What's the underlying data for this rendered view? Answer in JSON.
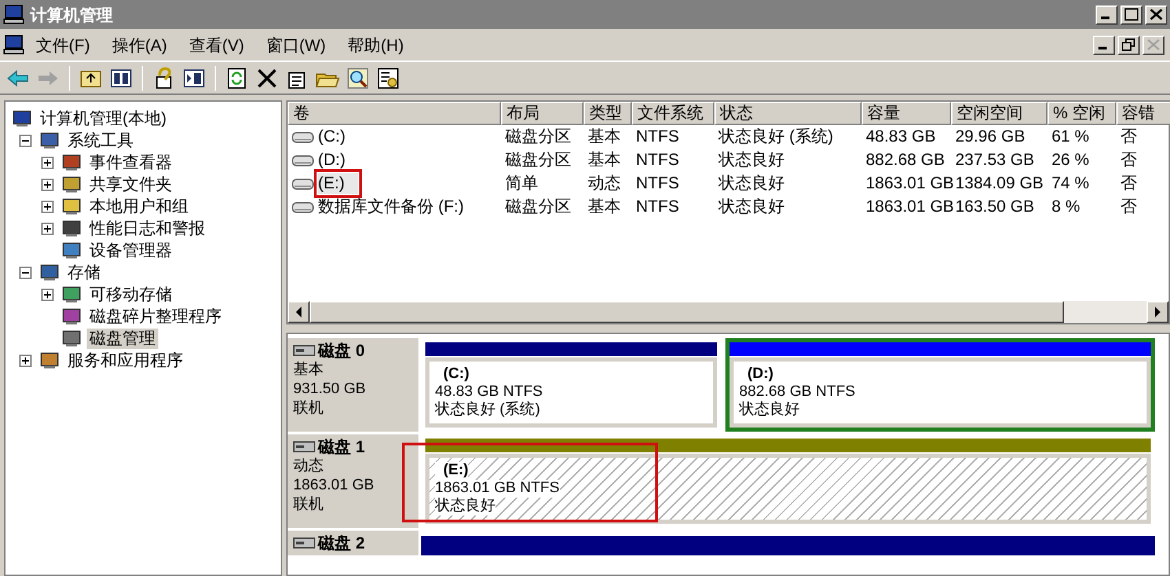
{
  "window": {
    "title": "计算机管理"
  },
  "menu": [
    "文件(F)",
    "操作(A)",
    "查看(V)",
    "窗口(W)",
    "帮助(H)"
  ],
  "tree": [
    {
      "label": "计算机管理(本地)",
      "selected": false,
      "children": [
        {
          "label": "系统工具",
          "expanded": true,
          "selected": false,
          "children": [
            {
              "label": "事件查看器",
              "expanded": false,
              "selected": false
            },
            {
              "label": "共享文件夹",
              "expanded": false,
              "selected": false
            },
            {
              "label": "本地用户和组",
              "expanded": false,
              "selected": false
            },
            {
              "label": "性能日志和警报",
              "expanded": false,
              "selected": false
            },
            {
              "label": "设备管理器",
              "selected": false
            }
          ]
        },
        {
          "label": "存储",
          "expanded": true,
          "selected": false,
          "children": [
            {
              "label": "可移动存储",
              "expanded": false,
              "selected": false
            },
            {
              "label": "磁盘碎片整理程序",
              "selected": false
            },
            {
              "label": "磁盘管理",
              "selected": true
            }
          ]
        },
        {
          "label": "服务和应用程序",
          "expanded": false,
          "selected": false
        }
      ]
    }
  ],
  "table": {
    "columns": [
      "卷",
      "布局",
      "类型",
      "文件系统",
      "状态",
      "容量",
      "空闲空间",
      "% 空闲",
      "容错"
    ],
    "rows": [
      {
        "cells": [
          "(C:)",
          "磁盘分区",
          "基本",
          "NTFS",
          "状态良好 (系统)",
          "48.83 GB",
          "29.96 GB",
          "61 %",
          "否"
        ],
        "highlighted": false
      },
      {
        "cells": [
          "(D:)",
          "磁盘分区",
          "基本",
          "NTFS",
          "状态良好",
          "882.68 GB",
          "237.53 GB",
          "26 %",
          "否"
        ],
        "highlighted": false
      },
      {
        "cells": [
          "(E:)",
          "简单",
          "动态",
          "NTFS",
          "状态良好",
          "1863.01 GB",
          "1384.09 GB",
          "74 %",
          "否"
        ],
        "highlighted": true
      },
      {
        "cells": [
          "数据库文件备份 (F:)",
          "磁盘分区",
          "基本",
          "NTFS",
          "状态良好",
          "1863.01 GB",
          "163.50 GB",
          "8 %",
          "否"
        ],
        "highlighted": false
      }
    ]
  },
  "disks": [
    {
      "name": "磁盘 0",
      "type": "基本",
      "size": "931.50 GB",
      "status": "联机",
      "partitions": [
        {
          "kind": "primary",
          "label": "(C:)",
          "size_fs": "48.83 GB NTFS",
          "status": "状态良好 (系统)",
          "color": "#000080",
          "selected": false,
          "highlighted": false
        },
        {
          "kind": "primary",
          "label": "(D:)",
          "size_fs": "882.68 GB NTFS",
          "status": "状态良好",
          "color": "#0000ff",
          "selected": true,
          "highlighted": false
        }
      ]
    },
    {
      "name": "磁盘 1",
      "type": "动态",
      "size": "1863.01 GB",
      "status": "联机",
      "partitions": [
        {
          "kind": "simple",
          "label": "(E:)",
          "size_fs": "1863.01 GB NTFS",
          "status": "状态良好",
          "color": "#808000",
          "selected": false,
          "highlighted": true
        }
      ]
    },
    {
      "name": "磁盘 2",
      "color": "#000080"
    }
  ]
}
